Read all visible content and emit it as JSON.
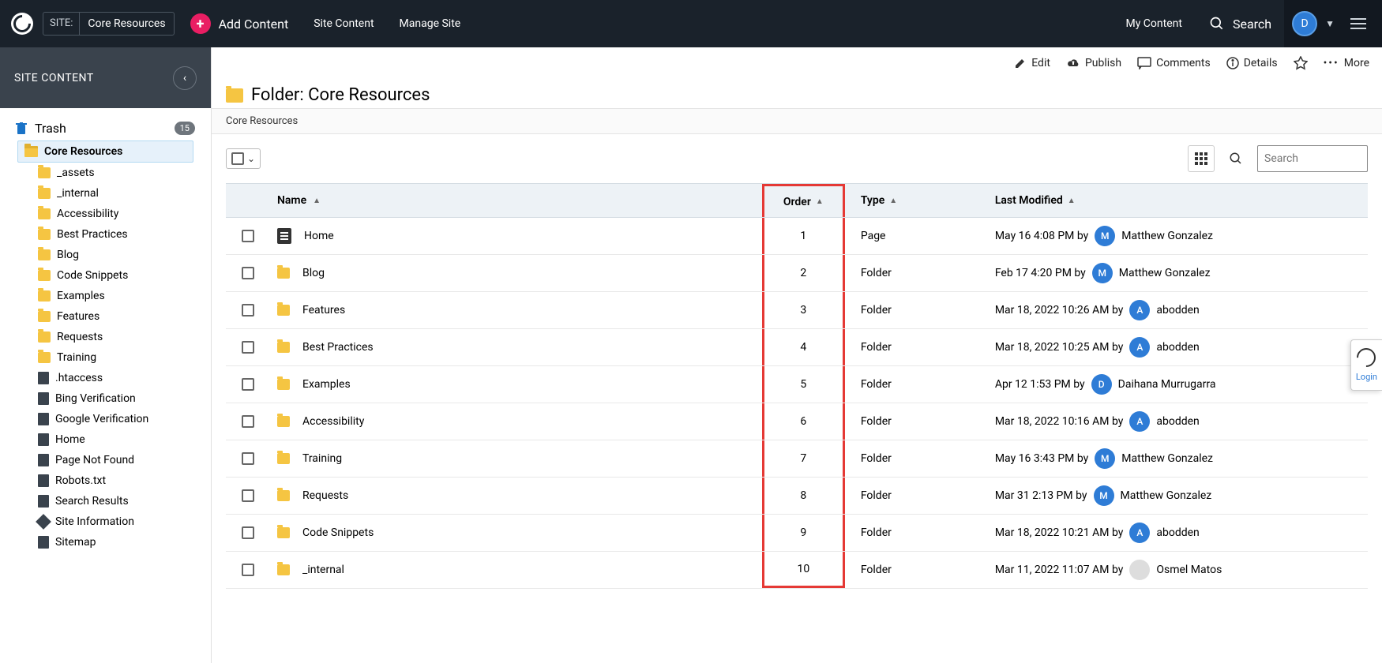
{
  "topbar": {
    "site_label": "SITE:",
    "site_name": "Core Resources",
    "add_content": "Add Content",
    "nav": [
      "Site Content",
      "Manage Site"
    ],
    "my_content": "My Content",
    "search": "Search",
    "avatar_initial": "D"
  },
  "sidebar": {
    "title": "SITE CONTENT",
    "trash": {
      "label": "Trash",
      "count": "15"
    },
    "root": "Core Resources",
    "items": [
      {
        "label": "_assets",
        "type": "folder"
      },
      {
        "label": "_internal",
        "type": "folder"
      },
      {
        "label": "Accessibility",
        "type": "folder"
      },
      {
        "label": "Best Practices",
        "type": "folder"
      },
      {
        "label": "Blog",
        "type": "folder"
      },
      {
        "label": "Code Snippets",
        "type": "folder"
      },
      {
        "label": "Examples",
        "type": "folder"
      },
      {
        "label": "Features",
        "type": "folder"
      },
      {
        "label": "Requests",
        "type": "folder"
      },
      {
        "label": "Training",
        "type": "folder"
      },
      {
        "label": ".htaccess",
        "type": "code"
      },
      {
        "label": "Bing Verification",
        "type": "code"
      },
      {
        "label": "Google Verification",
        "type": "code"
      },
      {
        "label": "Home",
        "type": "page"
      },
      {
        "label": "Page Not Found",
        "type": "page"
      },
      {
        "label": "Robots.txt",
        "type": "page"
      },
      {
        "label": "Search Results",
        "type": "page"
      },
      {
        "label": "Site Information",
        "type": "cube"
      },
      {
        "label": "Sitemap",
        "type": "page"
      }
    ]
  },
  "actions": {
    "edit": "Edit",
    "publish": "Publish",
    "comments": "Comments",
    "details": "Details",
    "more": "More"
  },
  "main": {
    "heading": "Folder: Core Resources",
    "breadcrumb": "Core Resources",
    "search_placeholder": "Search",
    "columns": {
      "name": "Name",
      "order": "Order",
      "type": "Type",
      "modified": "Last Modified"
    },
    "rows": [
      {
        "name": "Home",
        "order": "1",
        "type": "Page",
        "icon": "page",
        "date": "May 16 4:08 PM by",
        "user": "Matthew Gonzalez",
        "initial": "M"
      },
      {
        "name": "Blog",
        "order": "2",
        "type": "Folder",
        "icon": "folder",
        "date": "Feb 17 4:20 PM by",
        "user": "Matthew Gonzalez",
        "initial": "M"
      },
      {
        "name": "Features",
        "order": "3",
        "type": "Folder",
        "icon": "folder",
        "date": "Mar 18, 2022 10:26 AM by",
        "user": "abodden",
        "initial": "A"
      },
      {
        "name": "Best Practices",
        "order": "4",
        "type": "Folder",
        "icon": "folder",
        "date": "Mar 18, 2022 10:25 AM by",
        "user": "abodden",
        "initial": "A"
      },
      {
        "name": "Examples",
        "order": "5",
        "type": "Folder",
        "icon": "folder",
        "date": "Apr 12 1:53 PM by",
        "user": "Daihana Murrugarra",
        "initial": "D"
      },
      {
        "name": "Accessibility",
        "order": "6",
        "type": "Folder",
        "icon": "folder",
        "date": "Mar 18, 2022 10:16 AM by",
        "user": "abodden",
        "initial": "A"
      },
      {
        "name": "Training",
        "order": "7",
        "type": "Folder",
        "icon": "folder",
        "date": "May 16 3:43 PM by",
        "user": "Matthew Gonzalez",
        "initial": "M"
      },
      {
        "name": "Requests",
        "order": "8",
        "type": "Folder",
        "icon": "folder",
        "date": "Mar 31 2:13 PM by",
        "user": "Matthew Gonzalez",
        "initial": "M"
      },
      {
        "name": "Code Snippets",
        "order": "9",
        "type": "Folder",
        "icon": "folder",
        "date": "Mar 18, 2022 10:21 AM by",
        "user": "abodden",
        "initial": "A"
      },
      {
        "name": "_internal",
        "order": "10",
        "type": "Folder",
        "icon": "folder",
        "date": "Mar 11, 2022 11:07 AM by",
        "user": "Osmel Matos",
        "initial": "img"
      }
    ]
  },
  "login_tab": "Login"
}
